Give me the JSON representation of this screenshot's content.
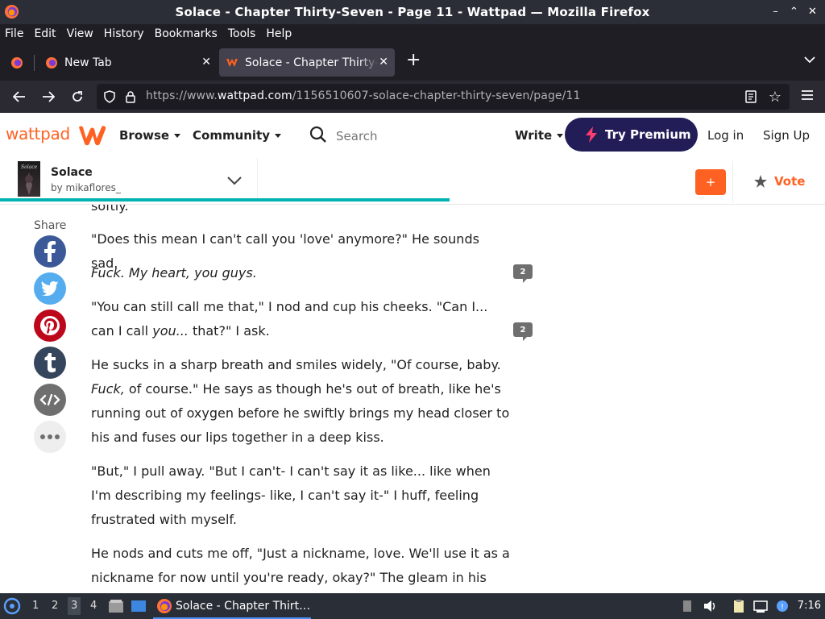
{
  "window": {
    "title": "Solace - Chapter Thirty-Seven - Page 11 - Wattpad — Mozilla Firefox",
    "controls": [
      "–",
      "⌃",
      "✕"
    ]
  },
  "menu": [
    "File",
    "Edit",
    "View",
    "History",
    "Bookmarks",
    "Tools",
    "Help"
  ],
  "tabs": [
    {
      "label": "New Tab"
    },
    {
      "label": "Solace - Chapter Thirty-Seven"
    }
  ],
  "url": {
    "prefix": "https://www.",
    "domain": "wattpad.com",
    "path": "/1156510607-solace-chapter-thirty-seven/page/11"
  },
  "wattpad": {
    "logo": "wattpad",
    "nav": {
      "browse": "Browse",
      "community": "Community"
    },
    "search_placeholder": "Search",
    "write": "Write",
    "premium": "Try Premium",
    "login": "Log in",
    "signup": "Sign Up"
  },
  "story": {
    "title": "Solace",
    "author": "by mikaflores_",
    "add": "+",
    "vote": "Vote",
    "progress": 0.545
  },
  "share": {
    "label": "Share"
  },
  "text": {
    "p0": "softly.",
    "p1": "\"Does this mean I can't call you 'love' anymore?\" He sounds sad.",
    "p2": "Fuck. My heart, you guys.",
    "p3a": "\"You can still call me that,\" I nod and cup his cheeks. \"Can I... can I call ",
    "p3b": "you...",
    "p3c": " that?\" I ask.",
    "p4a": "He sucks in a sharp breath and smiles widely, \"Of course, baby. ",
    "p4b": "Fuck,",
    "p4c": " of course.\" He says as though he's out of breath, like he's running out of oxygen before he swiftly brings my head closer to his and fuses our lips together in a deep kiss.",
    "p5": "\"But,\" I pull away. \"But I can't- I can't say it as like... like when I'm describing my feelings- like, I can't say it-\" I huff, feeling frustrated with myself.",
    "p6": "He nods and cuts me off, \"Just a nickname, love. We'll use it as a nickname for now until you're ready, okay?\" The gleam in his eyes"
  },
  "comments": {
    "c1": "2",
    "c2": "2"
  },
  "taskbar": {
    "workspaces": [
      "1",
      "2",
      "3",
      "4"
    ],
    "task_label": "Solace - Chapter Thirt…",
    "clock": "7:16"
  }
}
